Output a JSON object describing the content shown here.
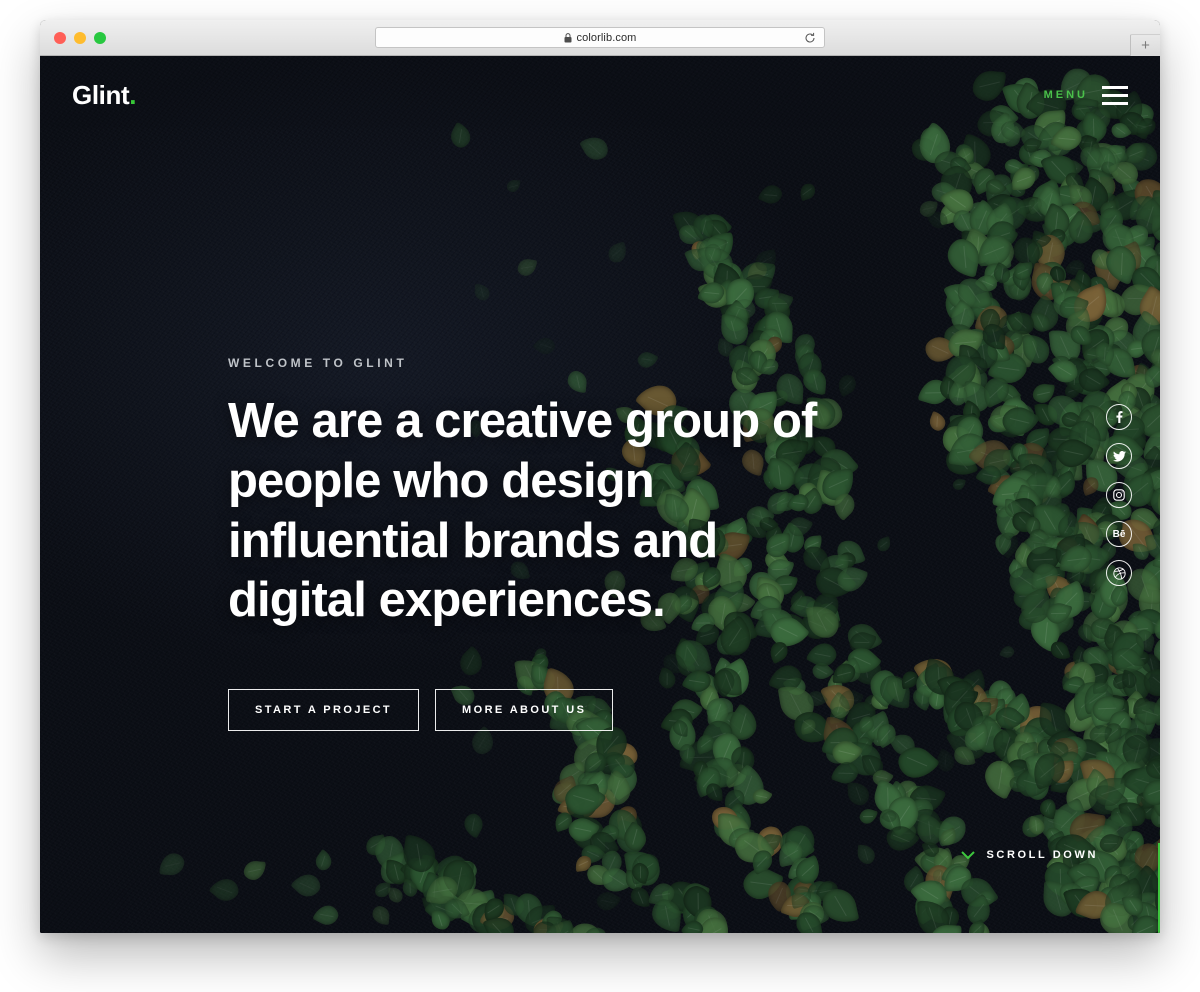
{
  "browser": {
    "url": "colorlib.com",
    "lock_icon": "lock-icon",
    "reload_icon": "reload-icon",
    "new_tab_label": "+",
    "traffic_lights": [
      "close",
      "minimize",
      "zoom"
    ]
  },
  "header": {
    "logo_text": "Glint",
    "logo_dot": ".",
    "menu_label": "MENU",
    "menu_icon": "hamburger-icon"
  },
  "hero": {
    "eyebrow": "WELCOME TO GLINT",
    "headline": "We are a creative group of people who design influential brands and digital experiences.",
    "buttons": [
      {
        "label": "START A PROJECT",
        "name": "start-a-project-button"
      },
      {
        "label": "MORE ABOUT US",
        "name": "more-about-us-button"
      }
    ]
  },
  "social": {
    "items": [
      {
        "name": "facebook-icon",
        "label": "f"
      },
      {
        "name": "twitter-icon",
        "label": "t"
      },
      {
        "name": "instagram-icon",
        "label": "ig"
      },
      {
        "name": "behance-icon",
        "label": "Bē"
      },
      {
        "name": "dribbble-icon",
        "label": "d"
      }
    ]
  },
  "scroll": {
    "label": "SCROLL DOWN",
    "icon": "chevron-down-icon"
  },
  "colors": {
    "accent_green": "#37c837",
    "menu_green": "#4ac14a",
    "scroll_rule_green": "#3ec63e",
    "background_dark": "#0a0d13",
    "text_white": "#ffffff",
    "eyebrow_grey": "#bfc3c8"
  }
}
